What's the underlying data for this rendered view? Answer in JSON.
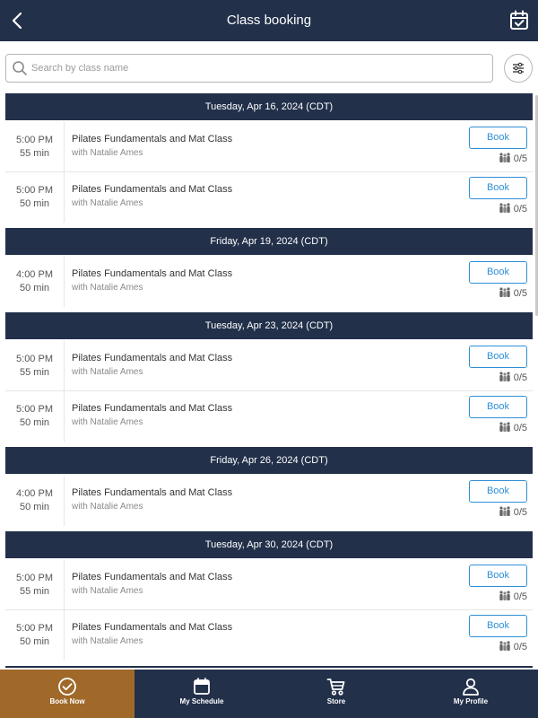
{
  "header": {
    "title": "Class booking",
    "back_icon": "chevron-left-icon",
    "calendar_icon": "calendar-check-icon"
  },
  "search": {
    "placeholder": "Search by class name",
    "value": ""
  },
  "filter_icon": "sliders-icon",
  "colors": {
    "header_bg": "#22304a",
    "accent_blue": "#2f8fd6",
    "active_tab": "#a0692a"
  },
  "days": [
    {
      "date": "Tuesday, Apr 16, 2024 (CDT)",
      "classes": [
        {
          "time": "5:00  PM",
          "duration": "55 min",
          "name": "Pilates Fundamentals and Mat Class",
          "instructor": "with Natalie Ames",
          "book": "Book",
          "capacity": "0/5"
        },
        {
          "time": "5:00  PM",
          "duration": "50 min",
          "name": "Pilates Fundamentals and Mat Class",
          "instructor": "with Natalie Ames",
          "book": "Book",
          "capacity": "0/5"
        }
      ]
    },
    {
      "date": "Friday, Apr 19, 2024 (CDT)",
      "classes": [
        {
          "time": "4:00  PM",
          "duration": "50 min",
          "name": "Pilates Fundamentals and Mat Class",
          "instructor": "with Natalie Ames",
          "book": "Book",
          "capacity": "0/5"
        }
      ]
    },
    {
      "date": "Tuesday, Apr 23, 2024 (CDT)",
      "classes": [
        {
          "time": "5:00  PM",
          "duration": "55 min",
          "name": "Pilates Fundamentals and Mat Class",
          "instructor": "with Natalie Ames",
          "book": "Book",
          "capacity": "0/5"
        },
        {
          "time": "5:00  PM",
          "duration": "50 min",
          "name": "Pilates Fundamentals and Mat Class",
          "instructor": "with Natalie Ames",
          "book": "Book",
          "capacity": "0/5"
        }
      ]
    },
    {
      "date": "Friday, Apr 26, 2024 (CDT)",
      "classes": [
        {
          "time": "4:00  PM",
          "duration": "50 min",
          "name": "Pilates Fundamentals and Mat Class",
          "instructor": "with Natalie Ames",
          "book": "Book",
          "capacity": "0/5"
        }
      ]
    },
    {
      "date": "Tuesday, Apr 30, 2024 (CDT)",
      "classes": [
        {
          "time": "5:00  PM",
          "duration": "55 min",
          "name": "Pilates Fundamentals and Mat Class",
          "instructor": "with Natalie Ames",
          "book": "Book",
          "capacity": "0/5"
        },
        {
          "time": "5:00  PM",
          "duration": "50 min",
          "name": "Pilates Fundamentals and Mat Class",
          "instructor": "with Natalie Ames",
          "book": "Book",
          "capacity": "0/5"
        }
      ]
    }
  ],
  "tabs": [
    {
      "label": "Book Now",
      "icon": "check-circle-icon",
      "active": true
    },
    {
      "label": "My Schedule",
      "icon": "calendar-icon",
      "active": false
    },
    {
      "label": "Store",
      "icon": "cart-icon",
      "active": false
    },
    {
      "label": "My Profile",
      "icon": "user-icon",
      "active": false
    }
  ]
}
